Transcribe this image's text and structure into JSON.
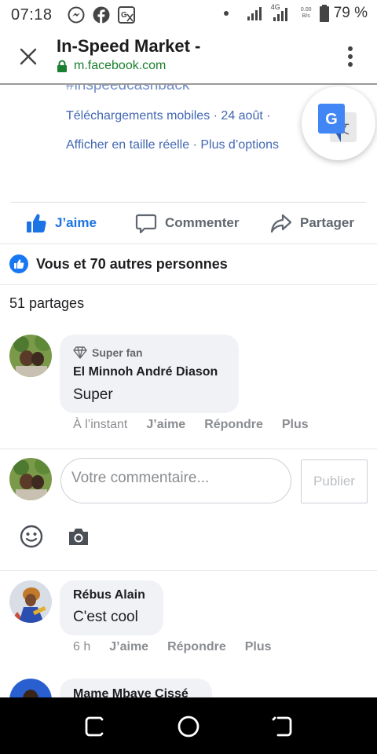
{
  "status_bar": {
    "time": "07:18",
    "network_label": "4G",
    "speed_value": "0.00",
    "speed_unit": "B/s",
    "battery": "79 %",
    "icons": [
      "facebook-messenger-icon",
      "facebook-icon",
      "translate-icon",
      "dot-icon",
      "signal-icon",
      "signal-4g-icon",
      "battery-icon"
    ]
  },
  "tab": {
    "title": "In-Speed Market -",
    "url": "m.facebook.com"
  },
  "post": {
    "hashtag": "#inspeedcashback",
    "meta_line1": "Téléchargements mobiles · 24 août · ",
    "meta_line2": "Afficher en taille réelle · Plus d’options"
  },
  "actions": {
    "like": "J’aime",
    "comment": "Commenter",
    "share": "Partager"
  },
  "likes_summary": "Vous et 70 autres personnes",
  "shares_summary": "51 partages",
  "comments": [
    {
      "badge": "Super fan",
      "author": "El Minnoh André Diason",
      "text": "Super",
      "time": "À l’instant",
      "like": "J’aime",
      "reply": "Répondre",
      "more": "Plus"
    },
    {
      "author": "Rébus Alain",
      "text": "C'est cool",
      "time": "6 h",
      "like": "J’aime",
      "reply": "Répondre",
      "more": "Plus"
    },
    {
      "author": "Mame Mbaye Cissé"
    }
  ],
  "composer": {
    "placeholder": "Votre commentaire...",
    "publish": "Publier"
  },
  "colors": {
    "facebook_blue": "#1877f2",
    "link_blue": "#4267b2",
    "secure_green": "#1a7f2e",
    "bubble_gray": "#f0f2f5"
  }
}
